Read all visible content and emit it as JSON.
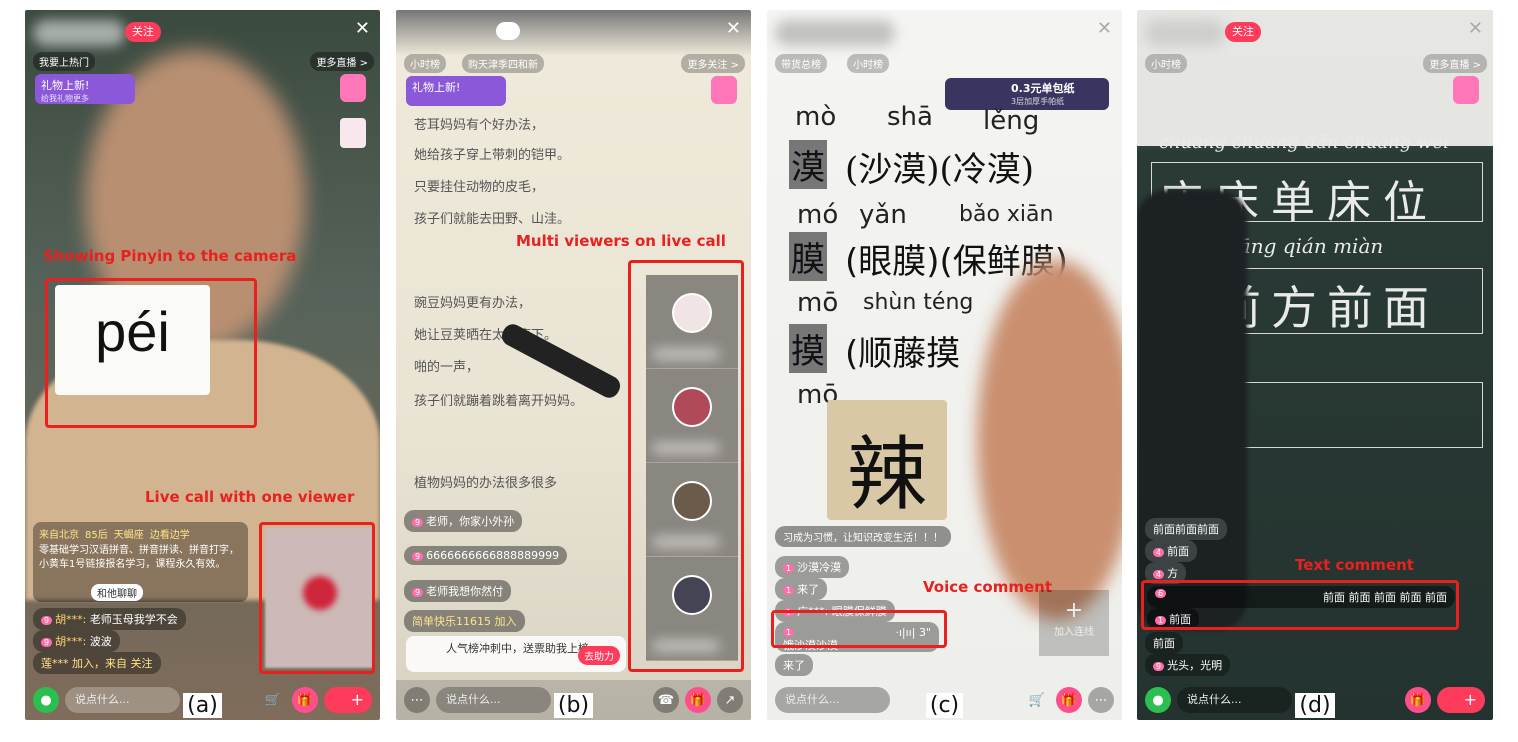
{
  "panel_a": {
    "follow": "关注",
    "hot_rank": "我要上热门",
    "more_live": "更多直播 >",
    "gift_banner": "礼物上新!",
    "gift_sub": "给我礼物更多",
    "pinyin_card": "péi",
    "annotation_top": "Showing Pinyin to the camera",
    "annotation_bottom": "Live call with one viewer",
    "info_tags": [
      "来自北京",
      "85后",
      "天蝎座",
      "边看边学"
    ],
    "info_text": "零基础学习汉语拼音、拼音拼读、拼音打字，小黄车1号链接报名学习，课程永久有效。",
    "chat_button": "和他聊聊",
    "comments": [
      {
        "user": "胡***:",
        "text": "老师玉母我学不会"
      },
      {
        "user": "胡***:",
        "text": "波波"
      },
      {
        "user": "",
        "text": "莲*** 加入，来自 关注"
      }
    ],
    "say_placeholder": "说点什么...",
    "label": "(a)"
  },
  "panel_b": {
    "small_rank": "小时榜",
    "region_rank": "购天津季四和新",
    "more_live": "更多关注 >",
    "gift_banner": "礼物上新!",
    "text_lines": [
      "苍耳妈妈有个好办法，",
      "她给孩子穿上带刺的铠甲。",
      "只要挂住动物的皮毛，",
      "孩子们就能去田野、山洼。",
      "豌豆妈妈更有办法，",
      "她让豆荚晒在太阳底下。",
      "啪的一声，",
      "孩子们就蹦着跳着离开妈妈。",
      "植物妈妈的办法很多很多"
    ],
    "annotation": "Multi viewers on live call",
    "comments": [
      {
        "text": "老师，你家小外孙"
      },
      {
        "text": "6666666666888889999"
      },
      {
        "text": "老师我想你然付"
      },
      {
        "text": "简单快乐11615 加入"
      }
    ],
    "rank_popup": "人气榜冲刺中，送票助我上榜",
    "help_button": "去助力",
    "say_placeholder": "说点什么...",
    "label": "(b)"
  },
  "panel_c": {
    "goods_rank": "带货总榜",
    "small_rank": "小时榜",
    "promo_price": "0.3元单包纸",
    "promo_sub": "3层加厚手帕纸",
    "pinyin": [
      "mò",
      "shā",
      "lěng",
      "mó",
      "yǎn",
      "bǎo xiān",
      "mō",
      "shùn téng",
      "mō"
    ],
    "rows": [
      "漠",
      "(沙漠)(冷漠)",
      "膜",
      "(眼膜)(保鲜膜)",
      "摸",
      "(顺藤摸"
    ],
    "flash_card": "辣",
    "annotation": "Voice comment",
    "comments": [
      {
        "text": "习成为习惯，让知识改变生活！！！"
      },
      {
        "text": "沙漠冷漠"
      },
      {
        "text": "来了"
      },
      {
        "text": "广***: 眼膜保鲜膜"
      },
      {
        "text": "饿沙漠沙漠"
      },
      {
        "text": "来了"
      }
    ],
    "voice_duration": "3\"",
    "add_link": "加入连线",
    "say_placeholder": "说点什么...",
    "label": "(c)"
  },
  "panel_d": {
    "follow": "关注",
    "small_rank": "小时榜",
    "more_live": "更多直播 >",
    "pinyin_row1": "chuáng chuáng dān chuáng wèi",
    "hanzi_row1": "床床单床位",
    "pinyin_row2": "qián fāng qián miàn",
    "hanzi_row2": "前前方前面",
    "annotation": "Text comment",
    "comments": [
      {
        "text": "前面前面前面"
      },
      {
        "text": "前面"
      },
      {
        "text": "方"
      },
      {
        "text": "前面 前面 前面 前面 前面"
      },
      {
        "text": "前面"
      },
      {
        "text": "前面"
      },
      {
        "text": "光头，光明"
      }
    ],
    "say_placeholder": "说点什么...",
    "label": "(d)"
  }
}
